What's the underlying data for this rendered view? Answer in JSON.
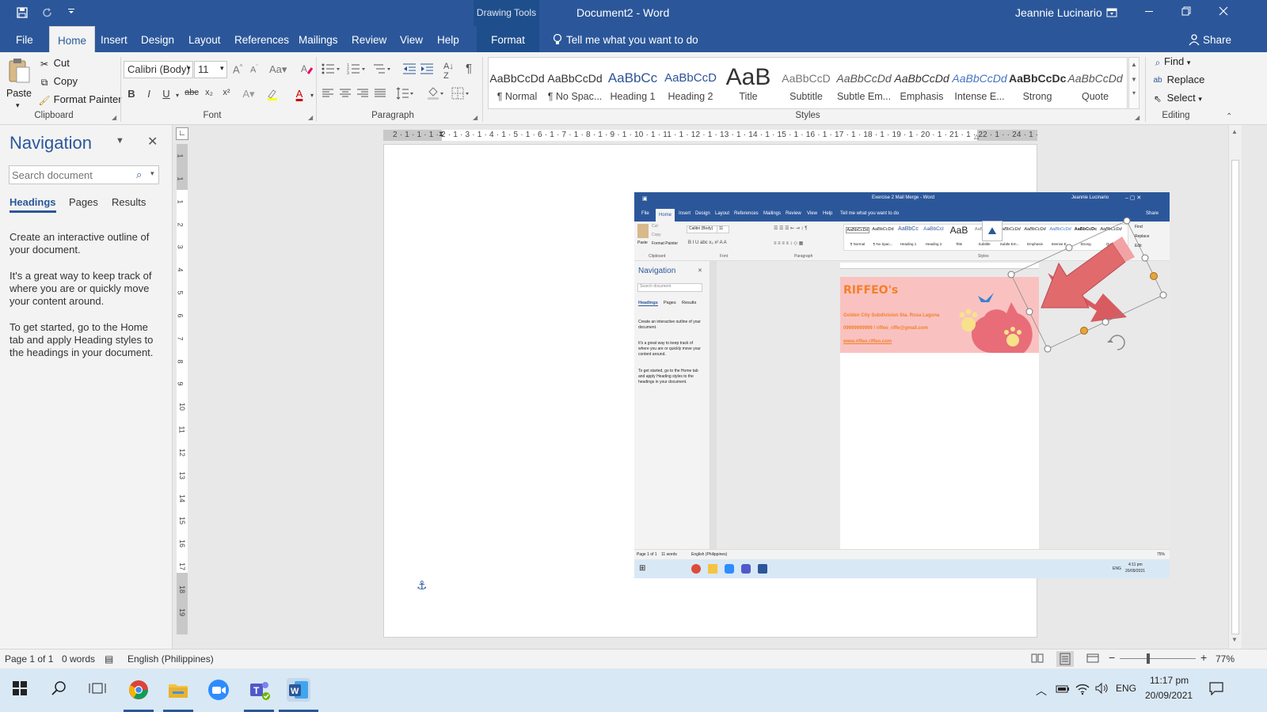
{
  "titlebar": {
    "drawing_tools": "Drawing Tools",
    "title": "Document2  -  Word",
    "user": "Jeannie Lucinario"
  },
  "tabs": [
    {
      "label": "File"
    },
    {
      "label": "Home"
    },
    {
      "label": "Insert"
    },
    {
      "label": "Design"
    },
    {
      "label": "Layout"
    },
    {
      "label": "References"
    },
    {
      "label": "Mailings"
    },
    {
      "label": "Review"
    },
    {
      "label": "View"
    },
    {
      "label": "Help"
    },
    {
      "label": "Format"
    }
  ],
  "tell_me": "Tell me what you want to do",
  "share": "Share",
  "clipboard": {
    "paste": "Paste",
    "cut": "Cut",
    "copy": "Copy",
    "format_painter": "Format Painter",
    "label": "Clipboard"
  },
  "font": {
    "name": "Calibri (Body)",
    "size": "11",
    "label": "Font"
  },
  "paragraph": {
    "label": "Paragraph"
  },
  "styles": {
    "label": "Styles",
    "items": [
      {
        "preview": "AaBbCcDd",
        "name": "¶ Normal"
      },
      {
        "preview": "AaBbCcDd",
        "name": "¶ No Spac..."
      },
      {
        "preview": "AaBbCc",
        "name": "Heading 1"
      },
      {
        "preview": "AaBbCcD",
        "name": "Heading 2"
      },
      {
        "preview": "AaB",
        "name": "Title"
      },
      {
        "preview": "AaBbCcD",
        "name": "Subtitle"
      },
      {
        "preview": "AaBbCcDd",
        "name": "Subtle Em..."
      },
      {
        "preview": "AaBbCcDd",
        "name": "Emphasis"
      },
      {
        "preview": "AaBbCcDd",
        "name": "Intense E..."
      },
      {
        "preview": "AaBbCcDc",
        "name": "Strong"
      },
      {
        "preview": "AaBbCcDd",
        "name": "Quote"
      }
    ]
  },
  "editing": {
    "find": "Find",
    "replace": "Replace",
    "select": "Select",
    "label": "Editing"
  },
  "navigation": {
    "title": "Navigation",
    "search_placeholder": "Search document",
    "tabs": [
      "Headings",
      "Pages",
      "Results"
    ],
    "p1": "Create an interactive outline of your document.",
    "p2": "It's a great way to keep track of where you are or quickly move your content around.",
    "p3": "To get started, go to the Home tab and apply Heading styles to the headings in your document."
  },
  "ruler_numbers": "2 · 1 · 1 · 1 · 2 · 1 · 3 · 1 · 4 · 1 · 5 · 1 · 6 · 1 · 7 · 1 · 8 · 1 · 9 · 1 · 10 · 1 · 11 · 1 · 12 · 1 · 13 · 1 · 14 · 1 · 15 · 1 · 16 · 1 · 17 · 1 · 18 · 1 · 19 · 1 · 20 · 1 · 21 · 1 · 22 · 1 · · 24 · 1 · 25",
  "vruler_numbers": [
    "1",
    "1",
    "1",
    "2",
    "3",
    "4",
    "5",
    "6",
    "7",
    "8",
    "9",
    "10",
    "11",
    "12",
    "13",
    "14",
    "15",
    "16",
    "17",
    "18",
    "19"
  ],
  "embedded": {
    "title": "Exercise 2 Mail Merge  -  Word",
    "user": "Jeannie Lucinario",
    "tabs": [
      "File",
      "Home",
      "Insert",
      "Design",
      "Layout",
      "References",
      "Mailings",
      "Review",
      "View",
      "Help"
    ],
    "tell_me": "Tell me what you want to do",
    "share": "Share",
    "nav_title": "Navigation",
    "nav_search": "Search document",
    "nav_tabs": [
      "Headings",
      "Pages",
      "Results"
    ],
    "nav_p1": "Create an interactive outline of your document.",
    "nav_p2": "It's a great way to keep track of where you are or quickly move your content around.",
    "nav_p3": "To get started, go to the Home tab and apply Heading styles to the headings in your document.",
    "card_title": "RIFFEO's",
    "card_line1": "Golden City Subdivision Sta. Rosa Laguna",
    "card_line2": "09999999999 / riffeo_riffe@gmail.com",
    "card_line3": "www.riffeo.riffeo.com",
    "status_page": "Page 1 of 1",
    "status_words": "11 words",
    "status_lang": "English (Philippines)",
    "zoom": "75%",
    "time": "4:11 pm",
    "date": "20/09/2021",
    "lang": "ENG",
    "style_names": [
      "¶ Normal",
      "¶ No Spac...",
      "Heading 1",
      "Heading 2",
      "Title",
      "Subtitle",
      "Subtle Em...",
      "Emphasis",
      "Intense E...",
      "Strong",
      "Quote"
    ],
    "clipboard_label": "Clipboard",
    "font_label": "Font",
    "paragraph_label": "Paragraph",
    "styles_label": "Styles",
    "find": "Find",
    "replace": "Replace",
    "edit": "Edit",
    "cut": "Cut",
    "copy": "Copy",
    "format_painter": "Format Painter",
    "paste": "Paste",
    "font_name": "Calibri (Body)",
    "font_size": "11"
  },
  "status": {
    "page": "Page 1 of 1",
    "words": "0 words",
    "language": "English (Philippines)",
    "zoom": "77%"
  },
  "taskbar": {
    "time": "11:17 pm",
    "date": "20/09/2021",
    "lang": "ENG"
  },
  "colors": {
    "word_blue": "#2b579a",
    "card_pink": "#f9c2c0",
    "card_orange": "#f47f2a",
    "arrow_red": "#e16a6d",
    "taskbar": "#d9e8f5"
  }
}
